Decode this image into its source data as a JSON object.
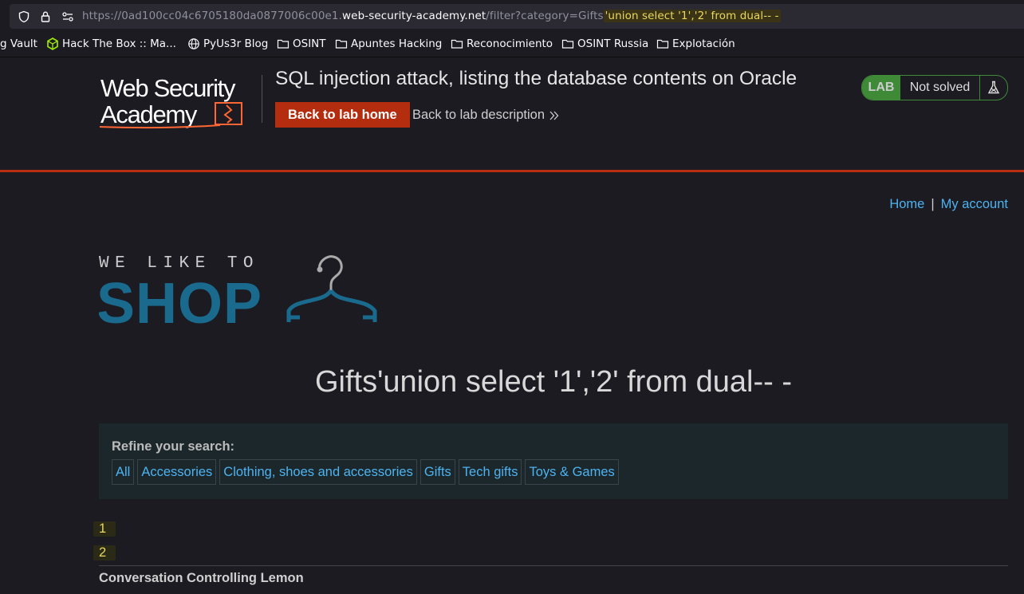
{
  "browser": {
    "url_prefix": "https://0ad100cc04c6705180da0877006c00e1.",
    "url_host": "web-security-academy.net",
    "url_path": "/filter?category=Gifts",
    "url_injection": "'union select '1','2' from dual-- -",
    "bookmarks": [
      {
        "label": "g Vault",
        "icon": "none"
      },
      {
        "label": "Hack The Box :: Ma...",
        "icon": "htb-icon"
      },
      {
        "label": "PyUs3r Blog",
        "icon": "globe-icon"
      },
      {
        "label": "OSINT",
        "icon": "folder-icon"
      },
      {
        "label": "Apuntes Hacking",
        "icon": "folder-icon"
      },
      {
        "label": "Reconocimiento",
        "icon": "folder-icon"
      },
      {
        "label": "OSINT Russia",
        "icon": "folder-icon"
      },
      {
        "label": "Explotación",
        "icon": "folder-icon"
      }
    ]
  },
  "lab": {
    "logo_line1": "Web Security",
    "logo_line2": "Academy",
    "title": "SQL injection attack, listing the database contents on Oracle",
    "back_home": "Back to lab home",
    "back_description": "Back to lab description",
    "badge": "LAB",
    "status": "Not solved"
  },
  "nav": {
    "home": "Home",
    "separator": "|",
    "my_account": "My account"
  },
  "shop_logo": {
    "tagline": "WE LIKE TO",
    "word": "SHOP"
  },
  "category_heading": "Gifts'union select '1','2' from dual-- -",
  "refine": {
    "label": "Refine your search:",
    "filters": [
      "All",
      "Accessories",
      "Clothing, shoes and accessories",
      "Gifts",
      "Tech gifts",
      "Toys & Games"
    ]
  },
  "results": {
    "values": [
      "1",
      "2"
    ],
    "product_name": "Conversation Controlling Lemon"
  },
  "colors": {
    "accent_red": "#b42d0e",
    "link_blue": "#4db3f0",
    "shop_blue": "#1a6a8e",
    "lab_green": "#3f8a37",
    "highlight_yellow": "#e9d85d"
  }
}
